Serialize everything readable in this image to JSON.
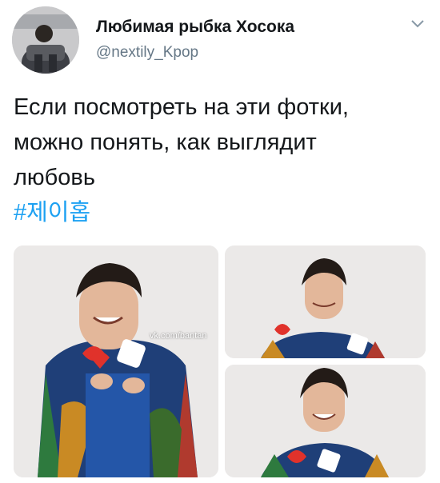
{
  "author": {
    "display_name": "Любимая рыбка Хосока",
    "handle": "@nextily_Kpop",
    "avatar_icon": "profile-photo"
  },
  "menu": {
    "icon": "chevron-down-icon"
  },
  "tweet": {
    "lines": [
      "Если посмотреть на эти фотки,",
      "можно понять, как выглядит",
      "любовь"
    ],
    "hashtag": "#제이홉"
  },
  "media": {
    "watermark": "vk.com/bantan",
    "count": 3
  },
  "colors": {
    "link": "#1da1f2",
    "secondary_text": "#657786",
    "primary_text": "#14171a"
  }
}
